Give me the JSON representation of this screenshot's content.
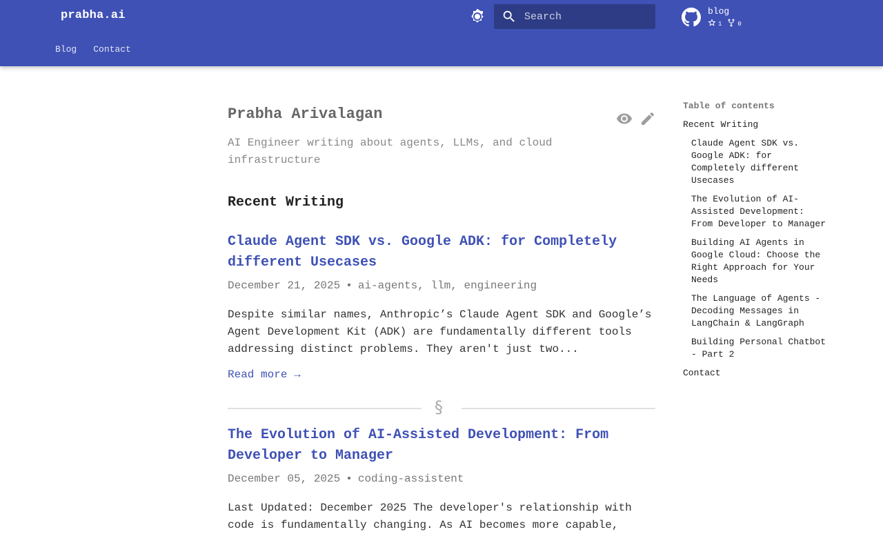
{
  "header": {
    "site_title": "prabha.ai",
    "search_placeholder": "Search",
    "repo": {
      "name": "blog",
      "stars": "1",
      "forks": "0"
    },
    "nav": [
      {
        "label": "Blog"
      },
      {
        "label": "Contact"
      }
    ]
  },
  "main": {
    "title": "Prabha Arivalagan",
    "subtitle": "AI Engineer writing about agents, LLMs, and cloud infrastructure",
    "section_heading": "Recent Writing",
    "posts": [
      {
        "title": "Claude Agent SDK vs. Google ADK: for Completely different Usecases",
        "date": "December 21, 2025",
        "tags": "ai-agents, llm, engineering",
        "excerpt": "Despite similar names, Anthropic’s Claude Agent SDK and Google’s Agent Development Kit (ADK) are fundamentally different tools addressing distinct problems. They aren't just two...",
        "read_more": "Read more →"
      },
      {
        "title": "The Evolution of AI-Assisted Development: From Developer to Manager",
        "date": "December 05, 2025",
        "tags": "coding-assistent",
        "excerpt": "Last Updated: December 2025 The developer's relationship with code is fundamentally changing. As AI becomes more capable,"
      }
    ],
    "meta_separator": "•",
    "divider_mark": "§"
  },
  "toc": {
    "title": "Table of contents",
    "items": [
      {
        "label": "Recent Writing"
      },
      {
        "label": "Claude Agent SDK vs. Google ADK: for Completely different Usecases"
      },
      {
        "label": "The Evolution of AI-Assisted Development: From Developer to Manager"
      },
      {
        "label": "Building AI Agents in Google Cloud: Choose the Right Approach for Your Needs"
      },
      {
        "label": "The Language of Agents - Decoding Messages in LangChain & LangGraph"
      },
      {
        "label": "Building Personal Chatbot - Part 2"
      },
      {
        "label": "Contact"
      }
    ]
  },
  "icons": {
    "theme": "brightness-icon",
    "search": "search-icon",
    "repo": "github-icon",
    "stars": "star-icon",
    "forks": "fork-icon",
    "view": "eye-icon",
    "edit": "pencil-icon"
  },
  "colors": {
    "primary": "#3f51b5",
    "link": "#3f51b5",
    "header_text": "#ffffff"
  }
}
